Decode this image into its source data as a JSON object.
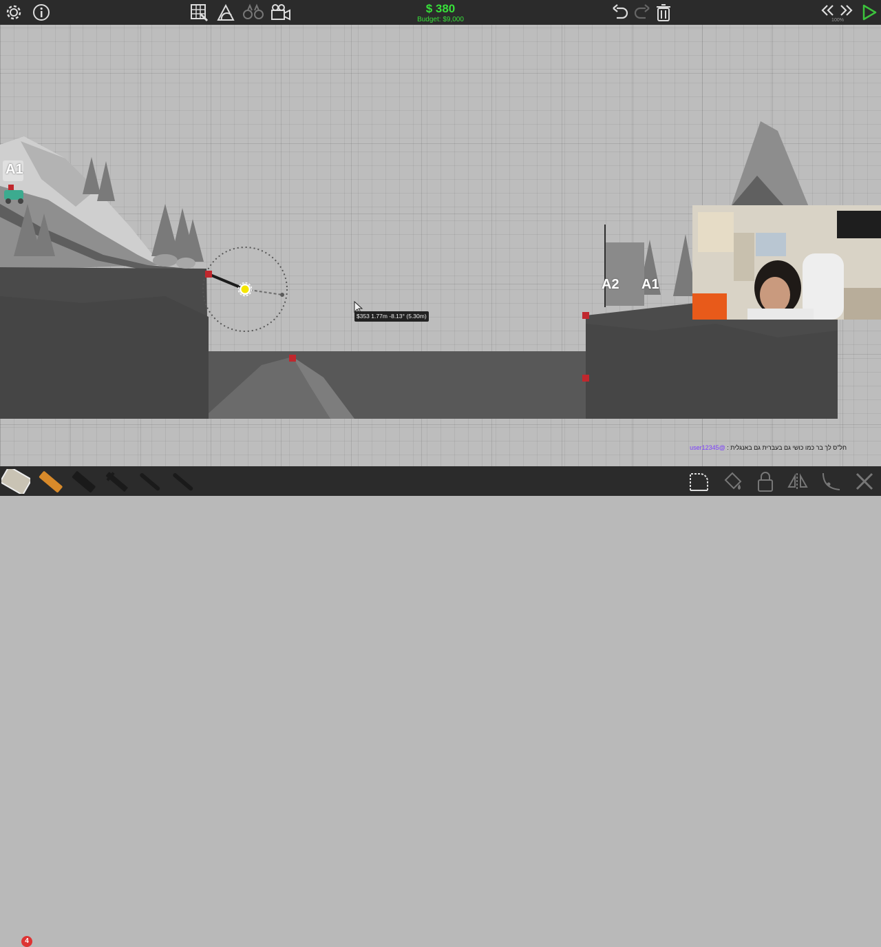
{
  "budget": {
    "amount": "$ 380",
    "label": "Budget: $9,000"
  },
  "sim": {
    "speed": "100%"
  },
  "anchors": {
    "left": "A1",
    "right_a2": "A2",
    "right_a1": "A1"
  },
  "tooltip": {
    "text": "$353  1.77m  -8.13°  (5.30m)"
  },
  "materials": {
    "road_count": "4"
  },
  "chat": {
    "username": "@user12345",
    "message": "חל\"ס לך בר כמו כושי גם בעברית גם באנגלית :"
  },
  "colors": {
    "topbar": "#2b2b2b",
    "budget": "#38e03a",
    "play": "#3cc43c",
    "joint": "#c0272d",
    "cursor_joint": "#f5e600"
  },
  "icons": {
    "top_left": [
      "gear-icon",
      "info-icon"
    ],
    "top_tools": [
      "grid-snap-icon",
      "stress-meter-icon",
      "binoculars-icon",
      "camera-icon"
    ],
    "top_right": [
      "undo-icon",
      "redo-icon",
      "trash-icon",
      "rewind-icon",
      "fast-forward-icon",
      "play-icon"
    ],
    "materials": [
      "road-material-icon",
      "wood-material-icon",
      "reinforced-road-icon",
      "steel-icon",
      "rope-icon",
      "cable-icon"
    ],
    "bottom_right": [
      "select-tool-icon",
      "paint-icon",
      "lock-icon",
      "mirror-icon",
      "split-joint-icon",
      "delete-tool-icon"
    ]
  }
}
